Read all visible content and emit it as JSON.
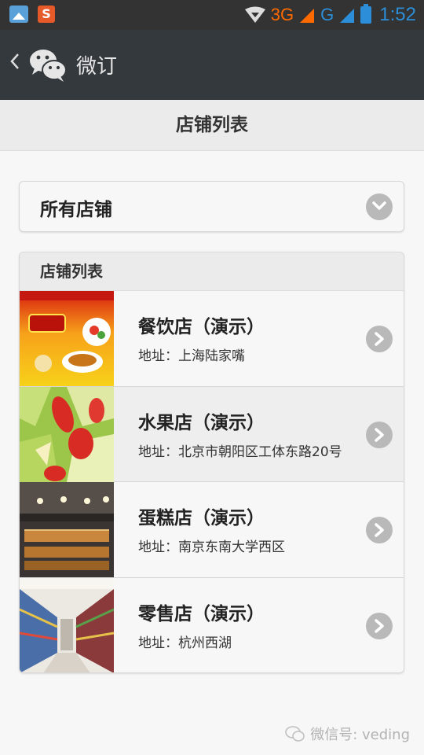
{
  "status_bar": {
    "network_3g": "3G",
    "network_g": "G",
    "time": "1:52",
    "colors": {
      "background": "#333333",
      "network_3g": "#ff6a00",
      "accent": "#2c8ed8"
    }
  },
  "titlebar": {
    "back_icon": "chevron-left-icon",
    "logo_icon": "wechat-logo-icon",
    "app_name": "微订"
  },
  "page": {
    "title": "店铺列表"
  },
  "filter": {
    "selected": "所有店铺"
  },
  "store_list": {
    "header": "店铺列表",
    "items": [
      {
        "name": "餐饮店（演示）",
        "address": "地址：上海陆家嘴"
      },
      {
        "name": "水果店（演示）",
        "address": "地址：北京市朝阳区工体东路20号"
      },
      {
        "name": "蛋糕店（演示）",
        "address": "地址：南京东南大学西区"
      },
      {
        "name": "零售店（演示）",
        "address": "地址：杭州西湖"
      }
    ]
  },
  "watermark": {
    "text": "微信号: veding"
  }
}
